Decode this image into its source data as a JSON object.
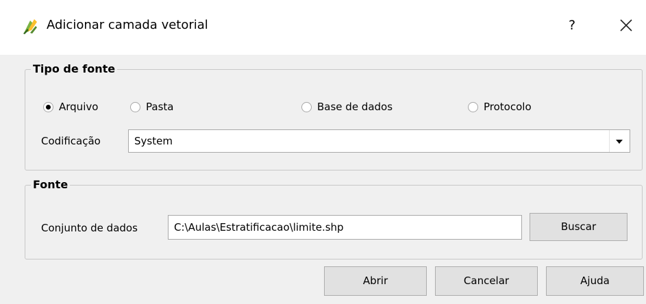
{
  "window": {
    "title": "Adicionar camada vetorial",
    "help_label": "?",
    "app_icon": "qgis-icon",
    "close_icon": "close-icon"
  },
  "source_type": {
    "group_title": "Tipo de fonte",
    "options": [
      {
        "label": "Arquivo",
        "checked": true
      },
      {
        "label": "Pasta",
        "checked": false
      },
      {
        "label": "Base de dados",
        "checked": false
      },
      {
        "label": "Protocolo",
        "checked": false
      }
    ],
    "encoding_label": "Codificação",
    "encoding_value": "System"
  },
  "source": {
    "group_title": "Fonte",
    "dataset_label": "Conjunto de dados",
    "dataset_value": "C:\\Aulas\\Estratificacao\\limite.shp",
    "browse_label": "Buscar"
  },
  "footer": {
    "open_label": "Abrir",
    "cancel_label": "Cancelar",
    "help_label": "Ajuda"
  },
  "colors": {
    "background": "#f0f0f0",
    "titlebar": "#ffffff",
    "button": "#e1e1e1",
    "border": "#adadad"
  }
}
